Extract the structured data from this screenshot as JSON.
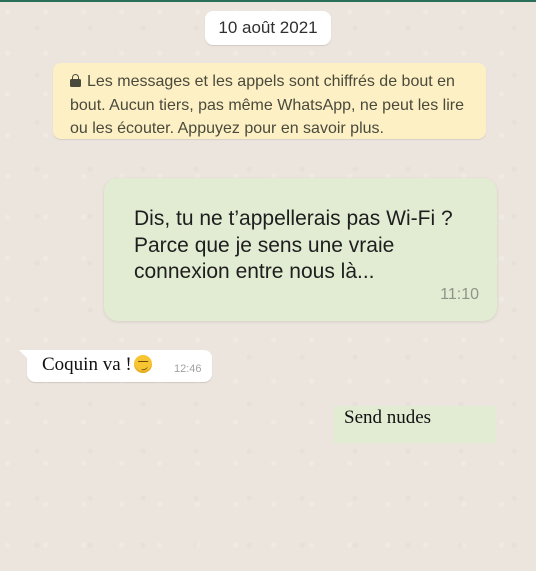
{
  "chat": {
    "date_separator": "10 août 2021",
    "encryption_notice": "Les messages et les appels sont chiffrés de bout en bout. Aucun tiers, pas même WhatsApp, ne peut les lire ou les écouter. Appuyez pour en savoir plus.",
    "encryption_icon": "lock-icon",
    "messages": [
      {
        "direction": "outgoing",
        "text": "Dis, tu ne t’appellerais pas Wi-Fi ? Parce que je sens une vraie connexion entre nous là...",
        "time": "11:10"
      },
      {
        "direction": "incoming",
        "text": "Coquin va !",
        "emoji": "smirking-face-icon",
        "time": "12:46"
      },
      {
        "direction": "outgoing",
        "text": "Send nudes"
      }
    ]
  },
  "colors": {
    "background": "#ece5dd",
    "outgoing_bubble": "#e2ecd3",
    "incoming_bubble": "#ffffff",
    "notice_bubble": "#fdf0c4"
  }
}
